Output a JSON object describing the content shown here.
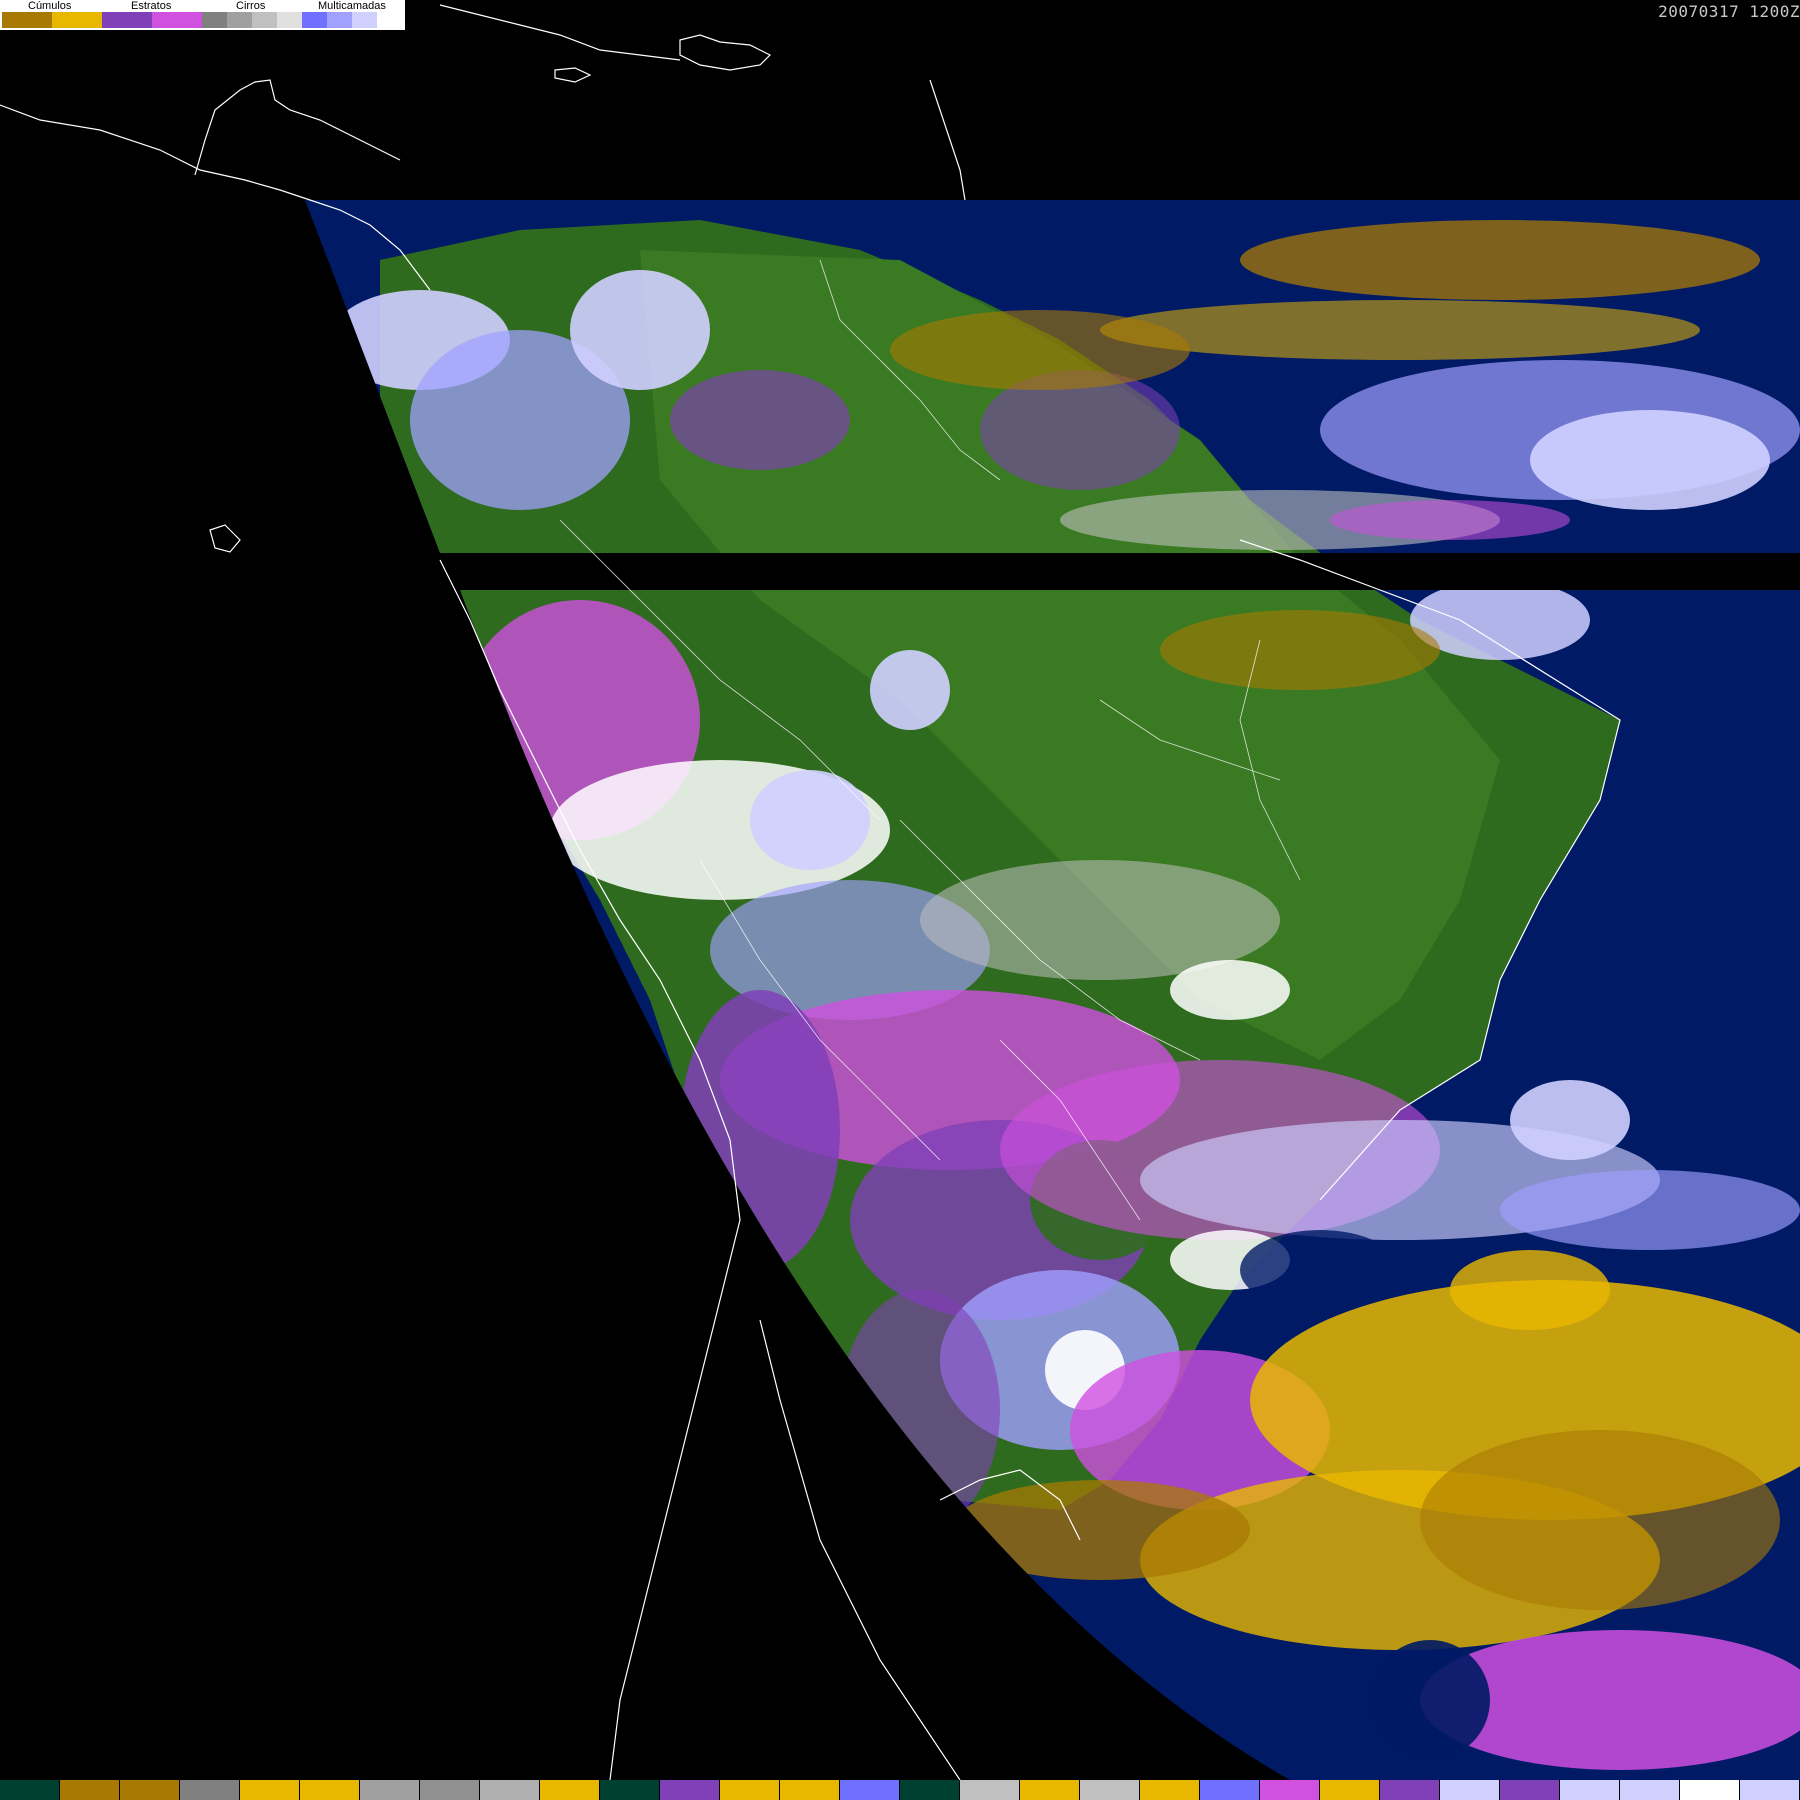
{
  "legend": {
    "labels": [
      "Cúmulos",
      "Estratos",
      "Cirros",
      "Multicamadas"
    ],
    "cumulos_colors": [
      "#a87a04",
      "#e8b800"
    ],
    "estratos_colors": [
      "#8040b8",
      "#d050e0"
    ],
    "cirros_colors": [
      "#808080",
      "#a0a0a0",
      "#c0c0c0",
      "#e0e0e0"
    ],
    "multicamadas_colors": [
      "#7070ff",
      "#a0a0ff",
      "#d0d0ff",
      "#ffffff"
    ]
  },
  "timestamp": "20070317  1200Z",
  "colors": {
    "ocean": "#001a66",
    "land": "#2f6b1e",
    "background": "#000000",
    "coastline": "#ffffff"
  },
  "bottom_bar_colors": [
    "#004030",
    "#a87a04",
    "#a87a04",
    "#808080",
    "#e8b800",
    "#e8b800",
    "#a0a0a0",
    "#909090",
    "#b0b0b0",
    "#e8b800",
    "#004030",
    "#8040b8",
    "#e8b800",
    "#e8b800",
    "#7070ff",
    "#004030",
    "#c0c0c0",
    "#e8b800",
    "#c0c0c0",
    "#e8b800",
    "#7070ff",
    "#d050e0",
    "#e8b800",
    "#8040b8",
    "#d0d0ff",
    "#8040b8",
    "#d0d0ff",
    "#d0d0ff",
    "#ffffff",
    "#d0d0ff"
  ]
}
